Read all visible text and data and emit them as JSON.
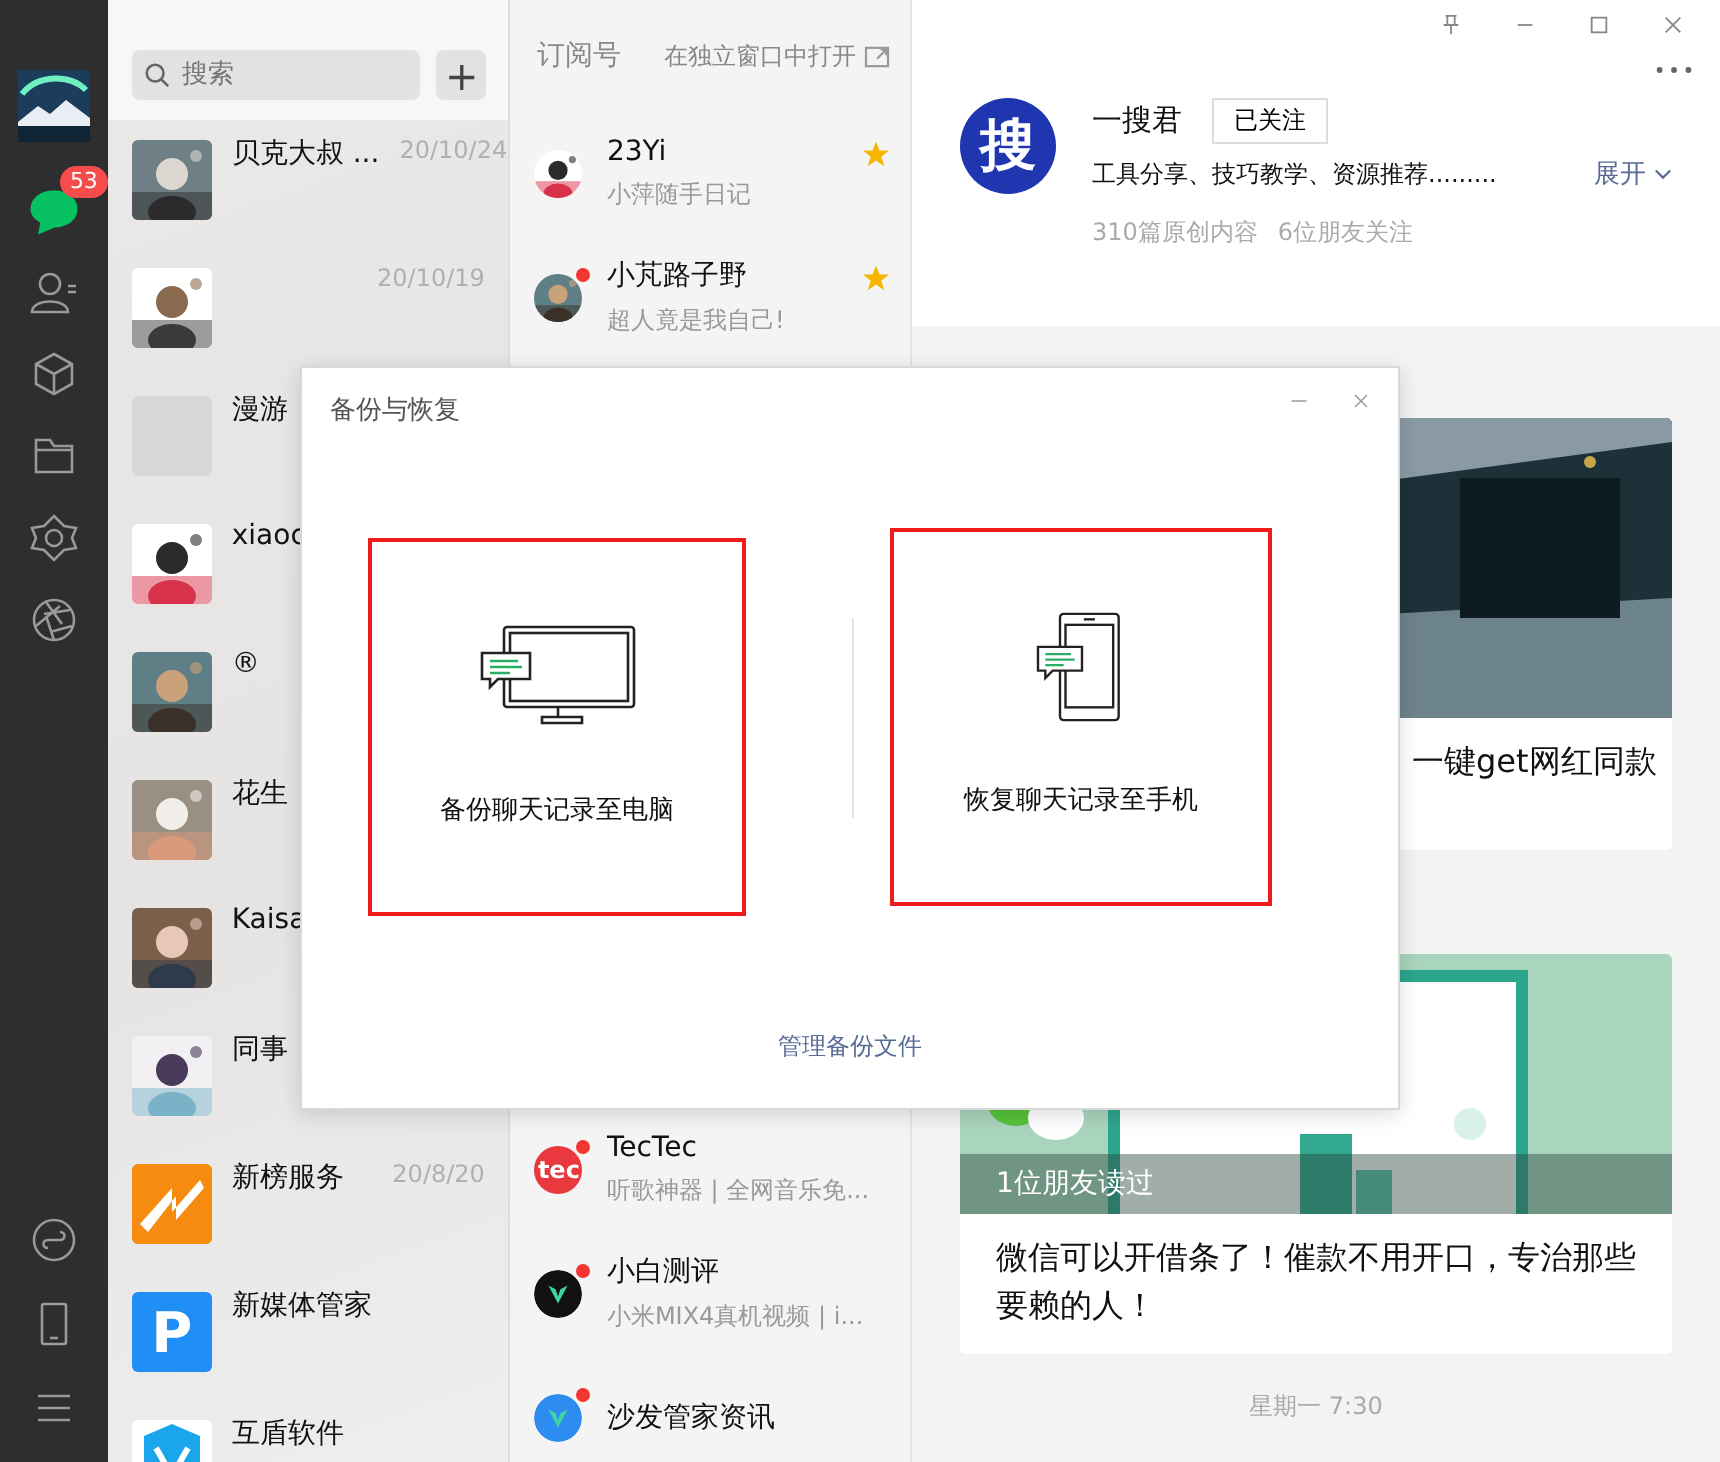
{
  "sidebar": {
    "items": [
      {
        "kind": "chat",
        "selected": true,
        "badge": "53"
      },
      {
        "kind": "contacts",
        "selected": false
      },
      {
        "kind": "cube",
        "selected": false
      },
      {
        "kind": "folder",
        "selected": false
      },
      {
        "kind": "flower",
        "selected": false
      },
      {
        "kind": "aperture",
        "selected": false
      }
    ],
    "bottom_items": [
      {
        "kind": "miniprogram"
      },
      {
        "kind": "phone"
      },
      {
        "kind": "menu"
      }
    ]
  },
  "chat_list": {
    "search": {
      "placeholder": "搜索"
    },
    "add_button": "+",
    "chats": [
      {
        "name": "贝克大叔 ...",
        "time": "20/10/24"
      },
      {
        "time": "20/10/19"
      },
      {
        "name": "漫游",
        "avatar": {
          "kind": "blank"
        }
      },
      {
        "name": "xiaoc"
      },
      {
        "name": "®"
      },
      {
        "name": "花生"
      },
      {
        "name": "Kaisa"
      },
      {
        "name": "同事"
      },
      {
        "name": "新榜服务",
        "time": "20/8/20",
        "avatar": {
          "kind": "stripe",
          "color": "#f68b0f"
        }
      },
      {
        "name": "新媒体管家",
        "avatar": {
          "kind": "letter",
          "color": "#1f8ff5",
          "text": "P"
        }
      },
      {
        "name": "互盾软件",
        "avatar": {
          "kind": "shield",
          "color": "#1aa5ec"
        }
      }
    ]
  },
  "subscriptions": {
    "title": "订阅号",
    "open_window": "在独立窗口中打开",
    "items": [
      {
        "name": "23Yi",
        "preview": "小萍随手日记",
        "starred": true,
        "unread": false
      },
      {
        "name": "小芃路子野",
        "preview": "超人竟是我自己!",
        "starred": true,
        "unread": true
      },
      {
        "name": "TecTec",
        "preview": "听歌神器 | 全网音乐免...",
        "starred": false,
        "unread": true,
        "avatar": {
          "kind": "letter",
          "color": "#e9393f",
          "text": "tec"
        }
      },
      {
        "name": "小白测评",
        "preview": "小米MIX4真机视频 | i...",
        "starred": false,
        "unread": true,
        "avatar": {
          "kind": "mark",
          "color": "#111111"
        }
      },
      {
        "name": "沙发管家资讯",
        "starred": false,
        "unread": true,
        "avatar": {
          "kind": "mark",
          "color": "#2d8cf0"
        }
      }
    ]
  },
  "account": {
    "logo": "搜",
    "name": "一搜君",
    "follow_button": "已关注",
    "description": "工具分享、技巧教学、资源推荐.........",
    "expand": "展开",
    "stats": [
      "310篇原创内容",
      "6位朋友关注"
    ],
    "articles": [
      {
        "title": "一键get网红同款"
      },
      {
        "title": "微信可以开借条了！催款不用开口，专治那些要赖的人！",
        "caption": "1位朋友读过"
      }
    ],
    "time": "星期一 7:30"
  },
  "dialog": {
    "title": "备份与恢复",
    "options": [
      {
        "kind": "computer",
        "label": "备份聊天记录至电脑",
        "highlighted": true
      },
      {
        "kind": "phone",
        "label": "恢复聊天记录至手机",
        "highlighted": true
      }
    ],
    "link": "管理备份文件"
  }
}
